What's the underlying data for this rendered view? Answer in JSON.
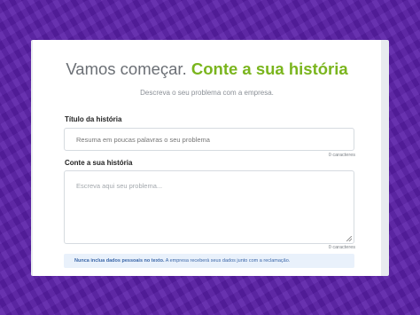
{
  "heading": {
    "prefix": "Vamos começar.",
    "highlight": "Conte a sua história",
    "subtitle": "Descreva o seu problema com a empresa."
  },
  "form": {
    "title_field": {
      "label": "Título da história",
      "placeholder": "Resuma em poucas palavras o seu problema",
      "value": "",
      "counter": "0 caracteres"
    },
    "story_field": {
      "label": "Conte a sua história",
      "placeholder": "Escreva aqui seu problema...",
      "value": "",
      "counter": "0 caracteres"
    }
  },
  "notice": {
    "bold": "Nunca inclua dados pessoais no texto.",
    "text": " A empresa receberá seus dados junto com a reclamação."
  },
  "colors": {
    "background": "#5a1fa8",
    "accent": "#7ab51d",
    "notice_bg": "#e9f1fb",
    "notice_text": "#3a66a8"
  }
}
